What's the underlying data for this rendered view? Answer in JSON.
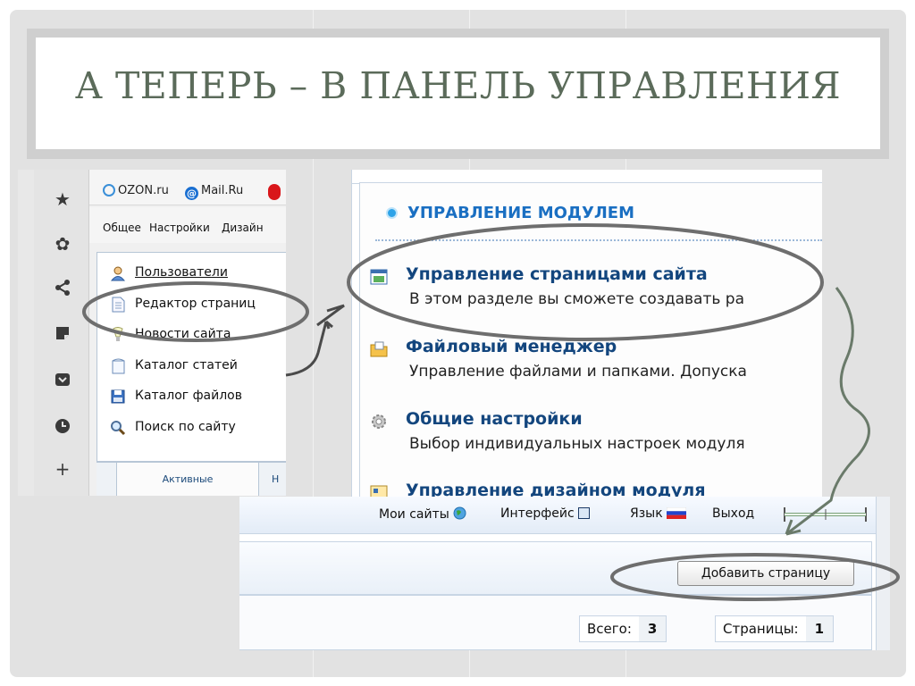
{
  "slide": {
    "title": "А ТЕПЕРЬ – В ПАНЕЛЬ УПРАВЛЕНИЯ"
  },
  "browser": {
    "bookmarks": [
      {
        "label": "OZON.ru",
        "icon": "ozon-icon"
      },
      {
        "label": "Mail.Ru",
        "icon": "mailru-icon"
      }
    ],
    "menu": [
      "Общее",
      "Настройки",
      "Дизайн"
    ],
    "sidebar_icons": [
      "star-icon",
      "gear-icon",
      "share-icon",
      "note-icon",
      "pocket-icon",
      "clock-icon",
      "plus-icon"
    ]
  },
  "nav_menu": {
    "items": [
      {
        "label": "Пользователи",
        "icon": "users-icon"
      },
      {
        "label": "Редактор страниц",
        "icon": "page-icon"
      },
      {
        "label": "Новости сайта",
        "icon": "news-icon"
      },
      {
        "label": "Каталог статей",
        "icon": "articles-icon"
      },
      {
        "label": "Каталог файлов",
        "icon": "save-icon"
      },
      {
        "label": "Поиск по сайту",
        "icon": "search-icon"
      }
    ],
    "tab_active": "Активные",
    "tab_next": "Н"
  },
  "module": {
    "title": "УПРАВЛЕНИЕ МОДУЛЕМ",
    "items": [
      {
        "head": "Управление страницами сайта",
        "desc": "В этом разделе вы сможете создавать ра"
      },
      {
        "head": "Файловый менеджер",
        "desc": "Управление файлами и папками. Допуска"
      },
      {
        "head": "Общие настройки",
        "desc": "Выбор индивидуальных настроек модуля"
      },
      {
        "head": "Управление дизайном модуля",
        "desc": ""
      }
    ]
  },
  "admin_bar": {
    "my_sites": "Мои сайты",
    "interface": "Интерфейс",
    "language": "Язык",
    "logout": "Выход",
    "add_page": "Добавить страницу",
    "total_label": "Всего:",
    "total_value": "3",
    "pages_label": "Страницы:",
    "pages_value": "1"
  },
  "colors": {
    "title_text": "#5b6b5a",
    "highlight_ellipse": "#6e6e6e",
    "module_title": "#1a6fc2",
    "module_heading": "#13467e"
  }
}
